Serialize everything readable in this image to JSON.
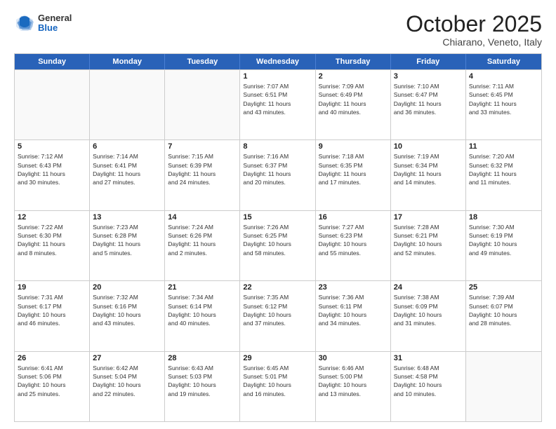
{
  "header": {
    "logo": {
      "general": "General",
      "blue": "Blue"
    },
    "title": "October 2025",
    "subtitle": "Chiarano, Veneto, Italy"
  },
  "weekdays": [
    "Sunday",
    "Monday",
    "Tuesday",
    "Wednesday",
    "Thursday",
    "Friday",
    "Saturday"
  ],
  "rows": [
    [
      {
        "day": "",
        "lines": []
      },
      {
        "day": "",
        "lines": []
      },
      {
        "day": "",
        "lines": []
      },
      {
        "day": "1",
        "lines": [
          "Sunrise: 7:07 AM",
          "Sunset: 6:51 PM",
          "Daylight: 11 hours",
          "and 43 minutes."
        ]
      },
      {
        "day": "2",
        "lines": [
          "Sunrise: 7:09 AM",
          "Sunset: 6:49 PM",
          "Daylight: 11 hours",
          "and 40 minutes."
        ]
      },
      {
        "day": "3",
        "lines": [
          "Sunrise: 7:10 AM",
          "Sunset: 6:47 PM",
          "Daylight: 11 hours",
          "and 36 minutes."
        ]
      },
      {
        "day": "4",
        "lines": [
          "Sunrise: 7:11 AM",
          "Sunset: 6:45 PM",
          "Daylight: 11 hours",
          "and 33 minutes."
        ]
      }
    ],
    [
      {
        "day": "5",
        "lines": [
          "Sunrise: 7:12 AM",
          "Sunset: 6:43 PM",
          "Daylight: 11 hours",
          "and 30 minutes."
        ]
      },
      {
        "day": "6",
        "lines": [
          "Sunrise: 7:14 AM",
          "Sunset: 6:41 PM",
          "Daylight: 11 hours",
          "and 27 minutes."
        ]
      },
      {
        "day": "7",
        "lines": [
          "Sunrise: 7:15 AM",
          "Sunset: 6:39 PM",
          "Daylight: 11 hours",
          "and 24 minutes."
        ]
      },
      {
        "day": "8",
        "lines": [
          "Sunrise: 7:16 AM",
          "Sunset: 6:37 PM",
          "Daylight: 11 hours",
          "and 20 minutes."
        ]
      },
      {
        "day": "9",
        "lines": [
          "Sunrise: 7:18 AM",
          "Sunset: 6:35 PM",
          "Daylight: 11 hours",
          "and 17 minutes."
        ]
      },
      {
        "day": "10",
        "lines": [
          "Sunrise: 7:19 AM",
          "Sunset: 6:34 PM",
          "Daylight: 11 hours",
          "and 14 minutes."
        ]
      },
      {
        "day": "11",
        "lines": [
          "Sunrise: 7:20 AM",
          "Sunset: 6:32 PM",
          "Daylight: 11 hours",
          "and 11 minutes."
        ]
      }
    ],
    [
      {
        "day": "12",
        "lines": [
          "Sunrise: 7:22 AM",
          "Sunset: 6:30 PM",
          "Daylight: 11 hours",
          "and 8 minutes."
        ]
      },
      {
        "day": "13",
        "lines": [
          "Sunrise: 7:23 AM",
          "Sunset: 6:28 PM",
          "Daylight: 11 hours",
          "and 5 minutes."
        ]
      },
      {
        "day": "14",
        "lines": [
          "Sunrise: 7:24 AM",
          "Sunset: 6:26 PM",
          "Daylight: 11 hours",
          "and 2 minutes."
        ]
      },
      {
        "day": "15",
        "lines": [
          "Sunrise: 7:26 AM",
          "Sunset: 6:25 PM",
          "Daylight: 10 hours",
          "and 58 minutes."
        ]
      },
      {
        "day": "16",
        "lines": [
          "Sunrise: 7:27 AM",
          "Sunset: 6:23 PM",
          "Daylight: 10 hours",
          "and 55 minutes."
        ]
      },
      {
        "day": "17",
        "lines": [
          "Sunrise: 7:28 AM",
          "Sunset: 6:21 PM",
          "Daylight: 10 hours",
          "and 52 minutes."
        ]
      },
      {
        "day": "18",
        "lines": [
          "Sunrise: 7:30 AM",
          "Sunset: 6:19 PM",
          "Daylight: 10 hours",
          "and 49 minutes."
        ]
      }
    ],
    [
      {
        "day": "19",
        "lines": [
          "Sunrise: 7:31 AM",
          "Sunset: 6:17 PM",
          "Daylight: 10 hours",
          "and 46 minutes."
        ]
      },
      {
        "day": "20",
        "lines": [
          "Sunrise: 7:32 AM",
          "Sunset: 6:16 PM",
          "Daylight: 10 hours",
          "and 43 minutes."
        ]
      },
      {
        "day": "21",
        "lines": [
          "Sunrise: 7:34 AM",
          "Sunset: 6:14 PM",
          "Daylight: 10 hours",
          "and 40 minutes."
        ]
      },
      {
        "day": "22",
        "lines": [
          "Sunrise: 7:35 AM",
          "Sunset: 6:12 PM",
          "Daylight: 10 hours",
          "and 37 minutes."
        ]
      },
      {
        "day": "23",
        "lines": [
          "Sunrise: 7:36 AM",
          "Sunset: 6:11 PM",
          "Daylight: 10 hours",
          "and 34 minutes."
        ]
      },
      {
        "day": "24",
        "lines": [
          "Sunrise: 7:38 AM",
          "Sunset: 6:09 PM",
          "Daylight: 10 hours",
          "and 31 minutes."
        ]
      },
      {
        "day": "25",
        "lines": [
          "Sunrise: 7:39 AM",
          "Sunset: 6:07 PM",
          "Daylight: 10 hours",
          "and 28 minutes."
        ]
      }
    ],
    [
      {
        "day": "26",
        "lines": [
          "Sunrise: 6:41 AM",
          "Sunset: 5:06 PM",
          "Daylight: 10 hours",
          "and 25 minutes."
        ]
      },
      {
        "day": "27",
        "lines": [
          "Sunrise: 6:42 AM",
          "Sunset: 5:04 PM",
          "Daylight: 10 hours",
          "and 22 minutes."
        ]
      },
      {
        "day": "28",
        "lines": [
          "Sunrise: 6:43 AM",
          "Sunset: 5:03 PM",
          "Daylight: 10 hours",
          "and 19 minutes."
        ]
      },
      {
        "day": "29",
        "lines": [
          "Sunrise: 6:45 AM",
          "Sunset: 5:01 PM",
          "Daylight: 10 hours",
          "and 16 minutes."
        ]
      },
      {
        "day": "30",
        "lines": [
          "Sunrise: 6:46 AM",
          "Sunset: 5:00 PM",
          "Daylight: 10 hours",
          "and 13 minutes."
        ]
      },
      {
        "day": "31",
        "lines": [
          "Sunrise: 6:48 AM",
          "Sunset: 4:58 PM",
          "Daylight: 10 hours",
          "and 10 minutes."
        ]
      },
      {
        "day": "",
        "lines": []
      }
    ]
  ]
}
